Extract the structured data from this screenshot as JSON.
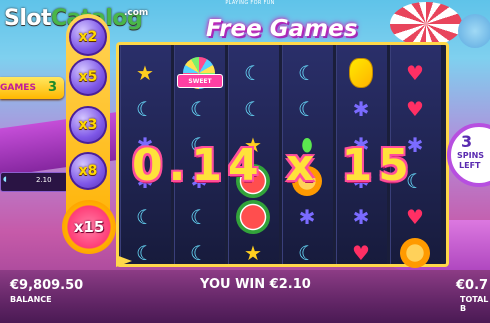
{
  "logo": {
    "part1": "Slot",
    "part2": "Catalog",
    "suffix": ".com"
  },
  "top_notice": "PLAYING FOR FUN",
  "game_title": "Free Games",
  "free_games_tag": {
    "label": "GAMES",
    "count": "3"
  },
  "left_meter": {
    "value": "2.10"
  },
  "multipliers": {
    "items": [
      "x2",
      "x5",
      "x3",
      "x8"
    ],
    "active": "x15"
  },
  "reels": {
    "symbols": [
      [
        "lollipop",
        "moon",
        "moon",
        "flower",
        "moon",
        "moon"
      ],
      [
        "moon",
        "moon",
        "star",
        "watermelon",
        "watermelon",
        "star"
      ],
      [
        "moon",
        "moon",
        "drop",
        "orange",
        "flower",
        "moon"
      ],
      [
        "pineapple",
        "flower",
        "flower",
        "flower",
        "flower",
        "heart"
      ],
      [
        "heart",
        "heart",
        "flower",
        "moon",
        "heart",
        "orange"
      ]
    ],
    "first_col_symbols": [
      "star",
      "moon",
      "flower",
      "flower",
      "moon",
      "moon"
    ],
    "sweet_tag": "SWEET"
  },
  "win_display": "0.14 x 15",
  "spins_left": {
    "count": "3",
    "label1": "SPINS",
    "label2": "LEFT"
  },
  "bottom": {
    "balance_value": "€9,809.50",
    "balance_label": "BALANCE",
    "you_win": "YOU WIN €2.10",
    "total_value": "€0.7",
    "total_label": "TOTAL B"
  },
  "colors": {
    "frame": "#ffd84a",
    "win_text": "#ffe23a",
    "win_outline": "#ff4f9a",
    "spins_ring": "#b74fe0"
  }
}
